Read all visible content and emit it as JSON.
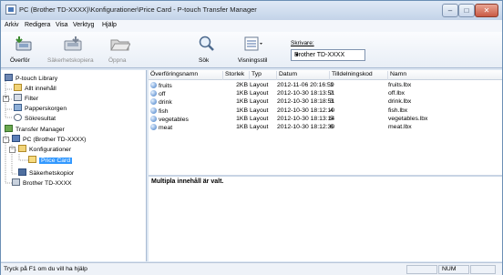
{
  "window": {
    "title": "PC (Brother TD-XXXX)\\Konfigurationer\\Price Card - P-touch Transfer Manager",
    "controls": {
      "minimize": "‒",
      "maximize": "□",
      "close": "✕"
    }
  },
  "menu": [
    "Arkiv",
    "Redigera",
    "Visa",
    "Verktyg",
    "Hjälp"
  ],
  "toolbar": {
    "transfer": "Överför",
    "backup": "Säkerhetskopiera",
    "open": "Öppna",
    "search": "Sök",
    "view_style": "Visningsstil",
    "printer_label": "Skrivare:",
    "printer_value": "Brother TD-XXXX"
  },
  "tree": {
    "ptouch_library": "P-touch Library",
    "all_content": "Allt innehåll",
    "filter": "Filter",
    "trash": "Papperskorgen",
    "search_results": "Sökresultat",
    "transfer_manager": "Transfer Manager",
    "pc": "PC (Brother TD-XXXX)",
    "configurations": "Konfigurationer",
    "price_card": "Price Card",
    "backups": "Säkerhetskopior",
    "brother": "Brother TD-XXXX"
  },
  "filelist": {
    "columns": [
      "Överföringsnamn",
      "Storlek",
      "Typ",
      "Datum",
      "Tilldelningskod",
      "Namn"
    ],
    "rows": [
      [
        "fruits",
        "2KB",
        "Layout",
        "2012-11-06 20:16:59",
        "1",
        "fruits.lbx"
      ],
      [
        "off",
        "1KB",
        "Layout",
        "2012-10-30 18:13:51",
        "2",
        "off.lbx"
      ],
      [
        "drink",
        "1KB",
        "Layout",
        "2012-10-30 18:18:51",
        "3",
        "drink.lbx"
      ],
      [
        "fish",
        "1KB",
        "Layout",
        "2012-10-30 18:12:10",
        "4",
        "fish.lbx"
      ],
      [
        "vegetables",
        "1KB",
        "Layout",
        "2012-10-30 18:13:14",
        "5",
        "vegetables.lbx"
      ],
      [
        "meat",
        "1KB",
        "Layout",
        "2012-10-30 18:12:30",
        "6",
        "meat.lbx"
      ]
    ]
  },
  "preview": {
    "message": "Multipla innehåll är valt."
  },
  "status": {
    "help": "Tryck på F1 om du vill ha hjälp",
    "num": "NUM"
  }
}
